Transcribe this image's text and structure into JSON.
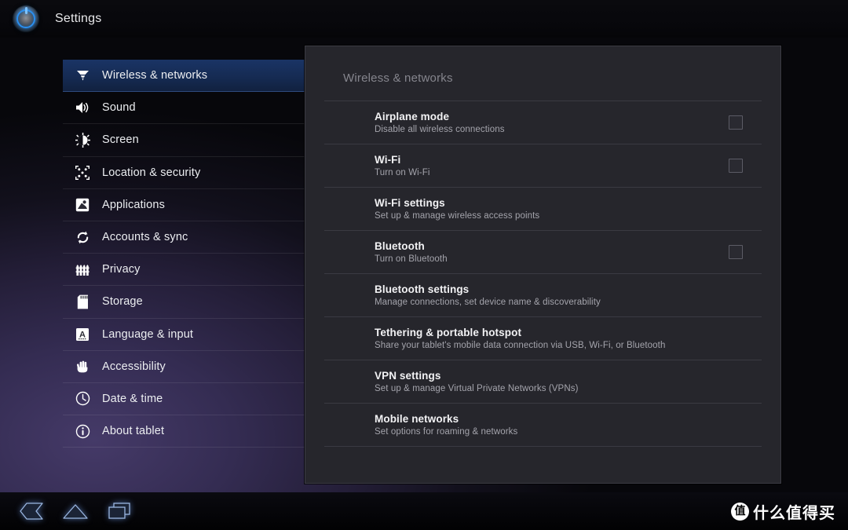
{
  "titlebar": {
    "app_icon": "settings-dial-icon",
    "title": "Settings"
  },
  "sidebar": {
    "items": [
      {
        "label": "Wireless & networks",
        "icon": "wireless-signal-icon",
        "selected": true
      },
      {
        "label": "Sound",
        "icon": "speaker-icon",
        "selected": false
      },
      {
        "label": "Screen",
        "icon": "brightness-icon",
        "selected": false
      },
      {
        "label": "Location & security",
        "icon": "location-grid-icon",
        "selected": false
      },
      {
        "label": "Applications",
        "icon": "applications-icon",
        "selected": false
      },
      {
        "label": "Accounts & sync",
        "icon": "sync-icon",
        "selected": false
      },
      {
        "label": "Privacy",
        "icon": "fence-icon",
        "selected": false
      },
      {
        "label": "Storage",
        "icon": "sdcard-icon",
        "selected": false
      },
      {
        "label": "Language & input",
        "icon": "language-a-icon",
        "selected": false
      },
      {
        "label": "Accessibility",
        "icon": "hand-icon",
        "selected": false
      },
      {
        "label": "Date & time",
        "icon": "clock-icon",
        "selected": false
      },
      {
        "label": "About tablet",
        "icon": "info-icon",
        "selected": false
      }
    ]
  },
  "panel": {
    "header": "Wireless & networks",
    "rows": [
      {
        "title": "Airplane mode",
        "subtitle": "Disable all wireless connections",
        "checkbox": true,
        "checked": false
      },
      {
        "title": "Wi-Fi",
        "subtitle": "Turn on Wi-Fi",
        "checkbox": true,
        "checked": false
      },
      {
        "title": "Wi-Fi settings",
        "subtitle": "Set up & manage wireless access points",
        "checkbox": false,
        "checked": false
      },
      {
        "title": "Bluetooth",
        "subtitle": "Turn on Bluetooth",
        "checkbox": true,
        "checked": false
      },
      {
        "title": "Bluetooth settings",
        "subtitle": "Manage connections, set device name & discoverability",
        "checkbox": false,
        "checked": false
      },
      {
        "title": "Tethering & portable hotspot",
        "subtitle": "Share your tablet's mobile data connection via USB, Wi-Fi, or Bluetooth",
        "checkbox": false,
        "checked": false
      },
      {
        "title": "VPN settings",
        "subtitle": "Set up & manage Virtual Private Networks (VPNs)",
        "checkbox": false,
        "checked": false
      },
      {
        "title": "Mobile networks",
        "subtitle": "Set options for roaming & networks",
        "checkbox": false,
        "checked": false
      }
    ]
  },
  "systembar": {
    "buttons": [
      {
        "name": "back-icon",
        "label": "Back"
      },
      {
        "name": "home-icon",
        "label": "Home"
      },
      {
        "name": "recent-apps-icon",
        "label": "Recent apps"
      }
    ]
  },
  "watermark": {
    "badge": "值",
    "text": "什么值得买"
  },
  "colors": {
    "selected_row": "#152a51",
    "panel_bg": "#26262c",
    "accent_blue": "#2a8ff0",
    "glow_purple": "#3a3157"
  }
}
